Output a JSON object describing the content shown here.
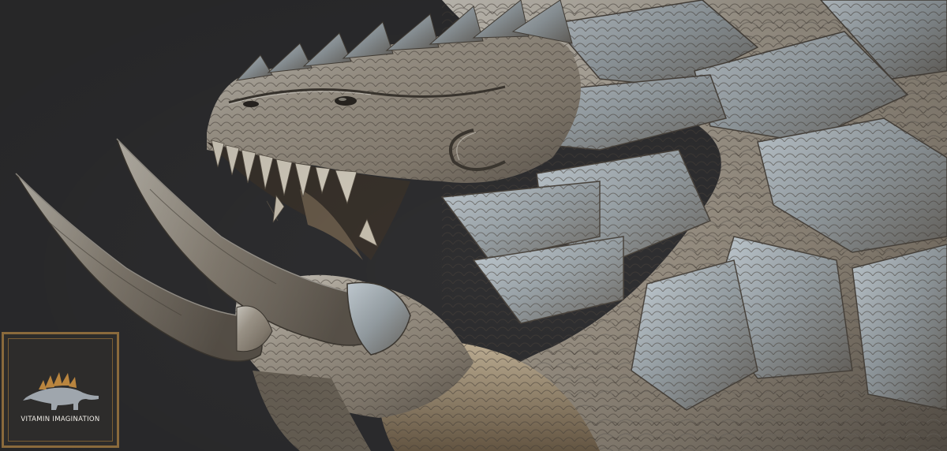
{
  "image": {
    "subject": "dragon-head-sculpt",
    "background_color": "#2f2f31",
    "surface_colors": [
      "#b8b1a4",
      "#7c7468",
      "#9fb0bd",
      "#a88f6b"
    ]
  },
  "logo": {
    "text": "VITAMIN IMAGINATION",
    "icon": "stegosaurus-icon",
    "border_color": "#8a6a3c",
    "text_color": "#f2efe9"
  }
}
